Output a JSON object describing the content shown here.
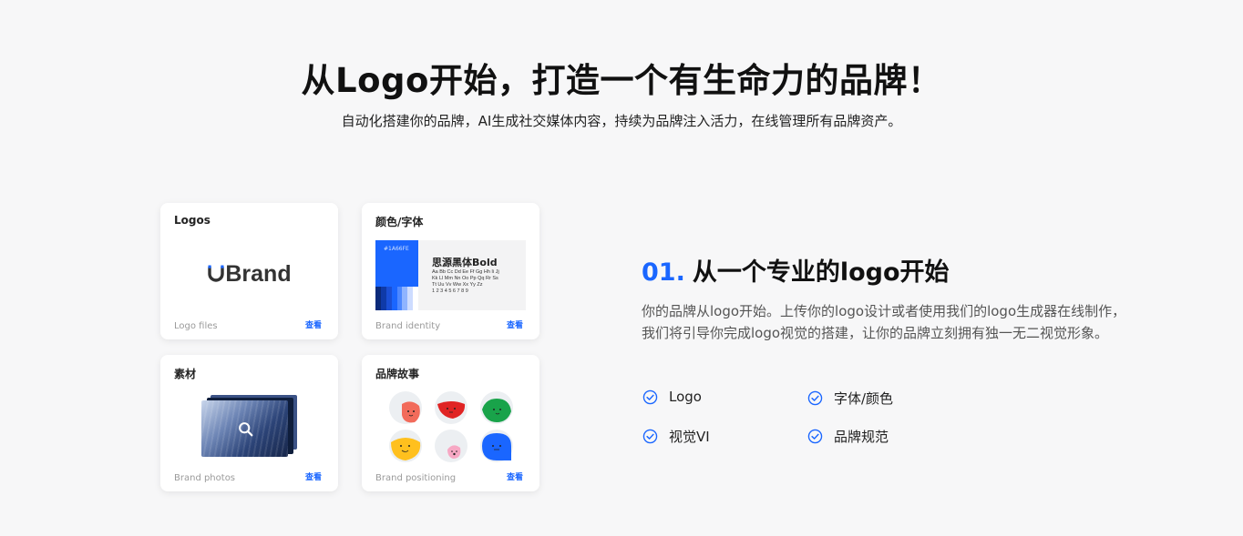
{
  "hero": {
    "title": "从Logo开始，打造一个有生命力的品牌！",
    "subtitle": "自动化搭建你的品牌，AI生成社交媒体内容，持续为品牌注入活力，在线管理所有品牌资产。"
  },
  "cards": {
    "logos": {
      "title": "Logos",
      "footer": "Logo files",
      "view": "查看",
      "brand_text": "Brand",
      "brand_prefix": "U"
    },
    "identity": {
      "title": "颜色/字体",
      "footer": "Brand identity",
      "view": "查看",
      "swatch_hex": "#1A66FE",
      "font_name": "思源黑体Bold",
      "sample_lines": [
        "Aa Bb Cc Dd Ee Ff Gg Hh Ii Jj",
        "Kk Ll Mm Nn Oo Pp Qq Rr Ss",
        "Tt Uu Vv Ww Xx Yy Zz",
        "1 2 3 4 5 6 7 8 9"
      ]
    },
    "photos": {
      "title": "素材",
      "footer": "Brand photos",
      "view": "查看"
    },
    "story": {
      "title": "品牌故事",
      "footer": "Brand positioning",
      "view": "查看"
    }
  },
  "feature": {
    "number": "01.",
    "title": "从一个专业的logo开始",
    "description": "你的品牌从logo开始。上传你的logo设计或者使用我们的logo生成器在线制作，我们将引导你完成logo视觉的搭建，让你的品牌立刻拥有独一无二视觉形象。",
    "checks": [
      "Logo",
      "字体/颜色",
      "视觉VI",
      "品牌规范"
    ]
  },
  "colors": {
    "accent": "#1a66ff",
    "ramp": [
      "#0b2a7a",
      "#0f3aa8",
      "#1a4fd6",
      "#1a66ff",
      "#4d88ff",
      "#8fb4ff",
      "#cddcff",
      "#ffffff"
    ]
  }
}
